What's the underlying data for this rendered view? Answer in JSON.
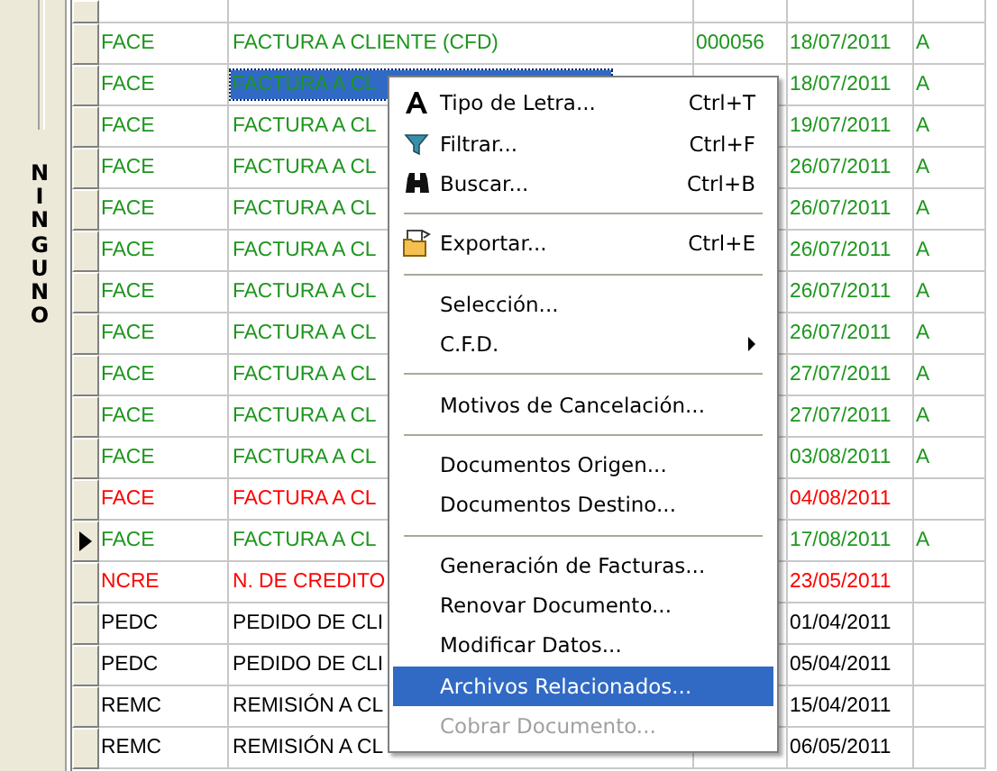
{
  "side_panel": {
    "label": "NINGUNO"
  },
  "grid": {
    "rows": [
      {
        "code": "FACE",
        "description": "FACTURA A CLIENTE (CFD)",
        "number": "000056",
        "date": "18/07/2011",
        "status": "A",
        "color": "#1e961e",
        "selected": false,
        "current": false
      },
      {
        "code": "FACE",
        "description": "FACTURA A CL",
        "date": "18/07/2011",
        "status": "A",
        "color": "#1e961e",
        "selected": true,
        "current": false
      },
      {
        "code": "FACE",
        "description": "FACTURA A CL",
        "date": "19/07/2011",
        "status": "A",
        "color": "#1e961e",
        "selected": false,
        "current": false
      },
      {
        "code": "FACE",
        "description": "FACTURA A CL",
        "date": "26/07/2011",
        "status": "A",
        "color": "#1e961e",
        "selected": false,
        "current": false
      },
      {
        "code": "FACE",
        "description": "FACTURA A CL",
        "date": "26/07/2011",
        "status": "A",
        "color": "#1e961e",
        "selected": false,
        "current": false
      },
      {
        "code": "FACE",
        "description": "FACTURA A CL",
        "date": "26/07/2011",
        "status": "A",
        "color": "#1e961e",
        "selected": false,
        "current": false
      },
      {
        "code": "FACE",
        "description": "FACTURA A CL",
        "date": "26/07/2011",
        "status": "A",
        "color": "#1e961e",
        "selected": false,
        "current": false
      },
      {
        "code": "FACE",
        "description": "FACTURA A CL",
        "date": "26/07/2011",
        "status": "A",
        "color": "#1e961e",
        "selected": false,
        "current": false
      },
      {
        "code": "FACE",
        "description": "FACTURA A CL",
        "date": "27/07/2011",
        "status": "A",
        "color": "#1e961e",
        "selected": false,
        "current": false
      },
      {
        "code": "FACE",
        "description": "FACTURA A CL",
        "date": "27/07/2011",
        "status": "A",
        "color": "#1e961e",
        "selected": false,
        "current": false
      },
      {
        "code": "FACE",
        "description": "FACTURA A CL",
        "date": "03/08/2011",
        "status": "A",
        "color": "#1e961e",
        "selected": false,
        "current": false
      },
      {
        "code": "FACE",
        "description": "FACTURA A CL",
        "date": "04/08/2011",
        "color": "#ff0000",
        "selected": false,
        "current": false
      },
      {
        "code": "FACE",
        "description": "FACTURA A CL",
        "date": "17/08/2011",
        "status": "A",
        "color": "#1e961e",
        "selected": false,
        "current": true
      },
      {
        "code": "NCRE",
        "description": "N. DE CREDITO",
        "date": "23/05/2011",
        "color": "#ff0000",
        "selected": false,
        "current": false
      },
      {
        "code": "PEDC",
        "description": "PEDIDO DE CLI",
        "date": "01/04/2011",
        "color": "#000000",
        "selected": false,
        "current": false
      },
      {
        "code": "PEDC",
        "description": "PEDIDO DE CLI",
        "date": "05/04/2011",
        "color": "#000000",
        "selected": false,
        "current": false
      },
      {
        "code": "REMC",
        "description": "REMISIÓN A CL",
        "date": "15/04/2011",
        "color": "#000000",
        "selected": false,
        "current": false
      },
      {
        "code": "REMC",
        "description": "REMISIÓN A CL",
        "date": "06/05/2011",
        "color": "#000000",
        "selected": false,
        "current": false
      }
    ]
  },
  "context_menu": {
    "items": [
      {
        "kind": "item",
        "label": "Tipo de Letra...",
        "shortcut": "Ctrl+T",
        "selected": false,
        "disabled": false
      },
      {
        "kind": "item",
        "label": "Filtrar...",
        "shortcut": "Ctrl+F",
        "selected": false,
        "disabled": false
      },
      {
        "kind": "item",
        "label": "Buscar...",
        "shortcut": "Ctrl+B",
        "selected": false,
        "disabled": false
      },
      {
        "kind": "separator"
      },
      {
        "kind": "item",
        "label": "Exportar...",
        "shortcut": "Ctrl+E",
        "selected": false,
        "disabled": false
      },
      {
        "kind": "separator"
      },
      {
        "kind": "item",
        "label": "Selección...",
        "selected": false,
        "disabled": false
      },
      {
        "kind": "submenu",
        "label": "C.F.D.",
        "selected": false,
        "disabled": false
      },
      {
        "kind": "separator"
      },
      {
        "kind": "item",
        "label": "Motivos de Cancelación...",
        "selected": false,
        "disabled": false
      },
      {
        "kind": "separator"
      },
      {
        "kind": "item",
        "label": "Documentos Origen...",
        "selected": false,
        "disabled": false
      },
      {
        "kind": "item",
        "label": "Documentos Destino...",
        "selected": false,
        "disabled": false
      },
      {
        "kind": "separator"
      },
      {
        "kind": "item",
        "label": "Generación de Facturas...",
        "selected": false,
        "disabled": false
      },
      {
        "kind": "item",
        "label": "Renovar Documento...",
        "selected": false,
        "disabled": false
      },
      {
        "kind": "item",
        "label": "Modificar Datos...",
        "selected": false,
        "disabled": false
      },
      {
        "kind": "item",
        "label": "Archivos Relacionados...",
        "selected": true,
        "disabled": false
      },
      {
        "kind": "item",
        "label": "Cobrar Documento...",
        "selected": false,
        "disabled": true
      }
    ]
  }
}
